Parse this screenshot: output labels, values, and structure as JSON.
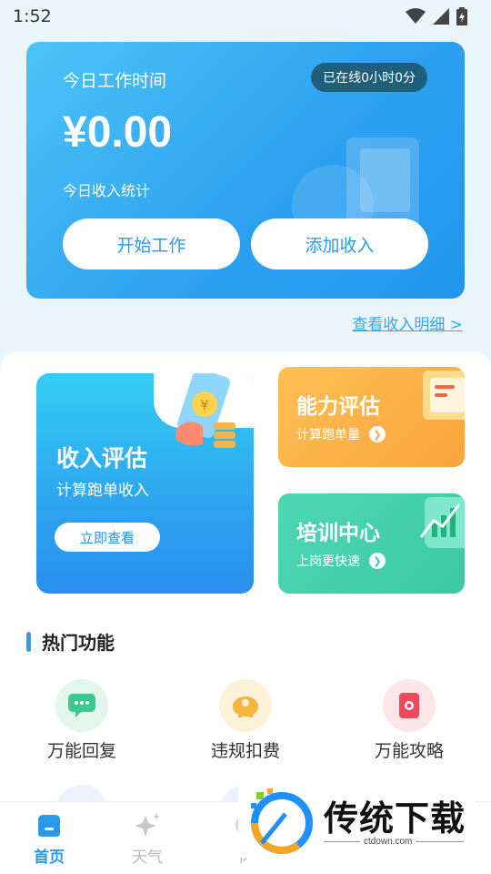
{
  "status_bar": {
    "time": "1:52"
  },
  "work_card": {
    "title": "今日工作时间",
    "online_badge": "已在线0小时0分",
    "amount": "¥0.00",
    "income_label": "今日收入统计",
    "start_button": "开始工作",
    "add_button": "添加收入"
  },
  "detail_link": "查看收入明细 >",
  "income_card": {
    "title": "收入评估",
    "subtitle": "计算跑单收入",
    "button": "立即查看"
  },
  "ability_card": {
    "title": "能力评估",
    "subtitle": "计算跑单量"
  },
  "training_card": {
    "title": "培训中心",
    "subtitle": "上岗更快速"
  },
  "hot_section": {
    "title": "热门功能"
  },
  "features": [
    {
      "label": "万能回复",
      "icon": "chat-bubble-icon",
      "color": "#3cc98f"
    },
    {
      "label": "违规扣费",
      "icon": "piggy-bank-icon",
      "color": "#f6b53c"
    },
    {
      "label": "万能攻略",
      "icon": "guide-book-icon",
      "color": "#ec4a5a"
    }
  ],
  "bottom_nav": [
    {
      "label": "首页",
      "icon": "home-icon"
    },
    {
      "label": "天气",
      "icon": "sparkle-icon"
    },
    {
      "label": "阝",
      "icon": "tab-icon"
    }
  ],
  "watermark": {
    "text": "传统下载",
    "url": "ctdown.com"
  },
  "colors": {
    "primary": "#2ea2f0",
    "orange": "#f8a53c",
    "green": "#3cc9a3"
  }
}
